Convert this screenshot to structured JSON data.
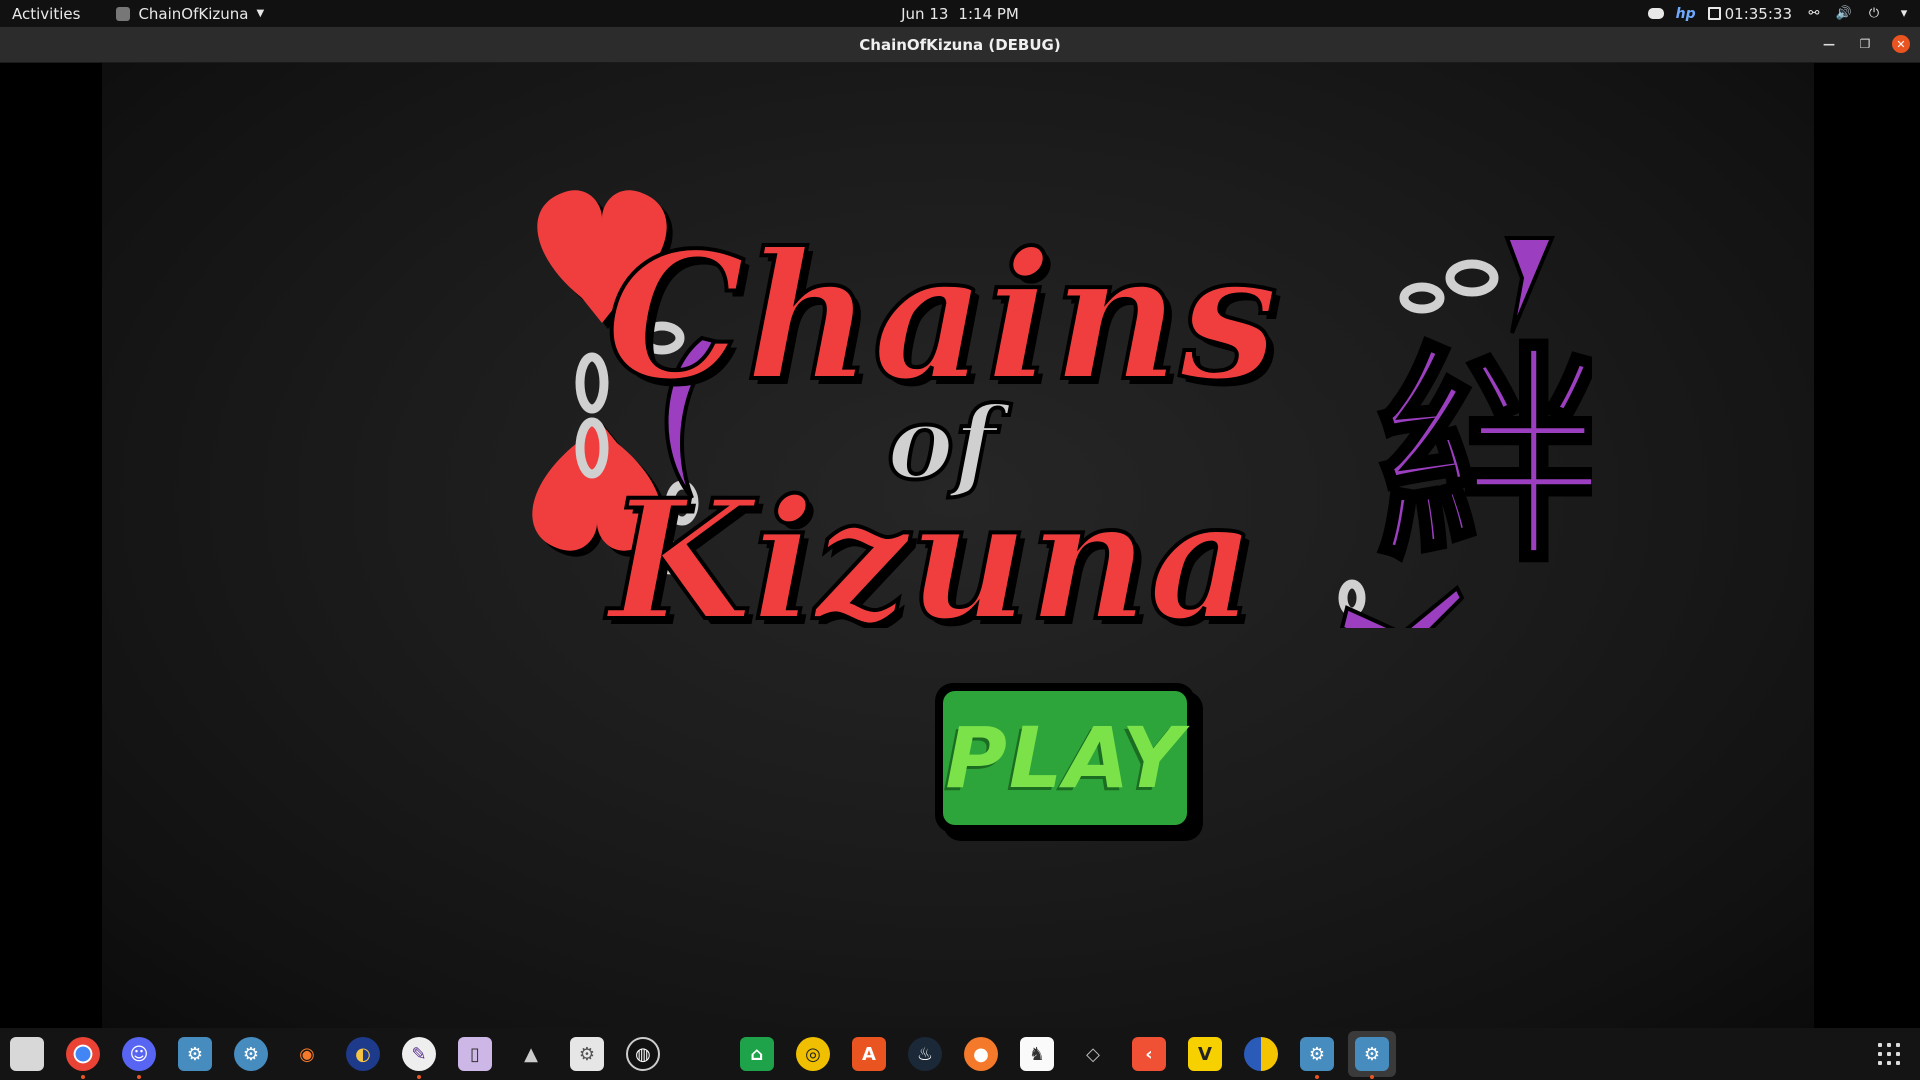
{
  "topbar": {
    "activities": "Activities",
    "app_menu": "ChainOfKizuna",
    "date": "Jun 13",
    "time": "1:14 PM",
    "battery_time": "01:35:33"
  },
  "window": {
    "title": "ChainOfKizuna (DEBUG)"
  },
  "game": {
    "logo_text": "Chains of Kizuna",
    "play_label": "PLAY",
    "colors": {
      "logo_red": "#f03e3e",
      "logo_purple": "#9b3fc0",
      "chain_gray": "#d0d0d0",
      "play_green": "#2da53b",
      "play_text": "#7be349"
    }
  },
  "dock": {
    "icons": [
      "files-icon",
      "chrome-icon",
      "discord-icon",
      "godot-icon",
      "godot-alt-icon",
      "blender-icon",
      "app-icon",
      "krita-icon",
      "itch-icon",
      "inkscape-icon",
      "settings-icon",
      "obs-icon",
      "app-icon",
      "rhythmbox-icon",
      "software-icon",
      "steam-icon",
      "blender-alt-icon",
      "game-icon",
      "unity-icon",
      "git-icon",
      "vector-icon",
      "app-icon",
      "godot-icon",
      "godot-active-icon"
    ]
  }
}
